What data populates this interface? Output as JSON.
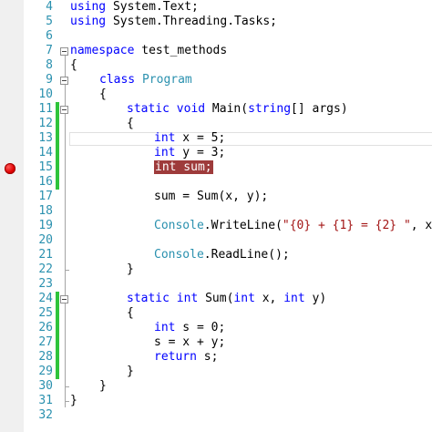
{
  "editor": {
    "line_numbers": [
      "4",
      "5",
      "6",
      "7",
      "8",
      "9",
      "10",
      "11",
      "12",
      "13",
      "14",
      "15",
      "16",
      "17",
      "18",
      "19",
      "20",
      "21",
      "22",
      "23",
      "24",
      "25",
      "26",
      "27",
      "28",
      "29",
      "30",
      "31",
      "32"
    ],
    "breakpoint_line": "15",
    "colors": {
      "keyword": "#0000ff",
      "type": "#2b91af",
      "string": "#a31515",
      "breakpoint": "#e00000",
      "breakpoint_highlight": "#9e3b3b",
      "change_bar": "#2fc43b"
    },
    "code": {
      "l4_kw": "using",
      "l4_rest": " System.Text;",
      "l5_kw": "using",
      "l5_rest": " System.Threading.Tasks;",
      "l7_kw": "namespace",
      "l7_rest": " test_methods",
      "l8": "{",
      "l9_kw": "class",
      "l9_type": "Program",
      "l10": "{",
      "l11_kw1": "static",
      "l11_kw2": "void",
      "l11_a": " Main(",
      "l11_kw3": "string",
      "l11_b": "[] args)",
      "l12": "{",
      "l13_kw": "int",
      "l13_rest": " x = 5;",
      "l14_kw": "int",
      "l14_rest": " y = 3;",
      "l15_kw": "int",
      "l15_rest": " sum;",
      "l17": "sum = Sum(x, y);",
      "l19_type": "Console",
      "l19_a": ".WriteLine(",
      "l19_str": "\"{0} + {1} = {2} \"",
      "l19_b": ", x,",
      "l21_type": "Console",
      "l21_rest": ".ReadLine();",
      "l22": "}",
      "l24_kw1": "static",
      "l24_kw2": "int",
      "l24_a": " Sum(",
      "l24_kw3": "int",
      "l24_b": " x, ",
      "l24_kw4": "int",
      "l24_c": " y)",
      "l25": "{",
      "l26_kw": "int",
      "l26_rest": " s = 0;",
      "l27": "s = x + y;",
      "l28_kw": "return",
      "l28_rest": " s;",
      "l29": "}",
      "l30": "}",
      "l31": "}"
    }
  }
}
